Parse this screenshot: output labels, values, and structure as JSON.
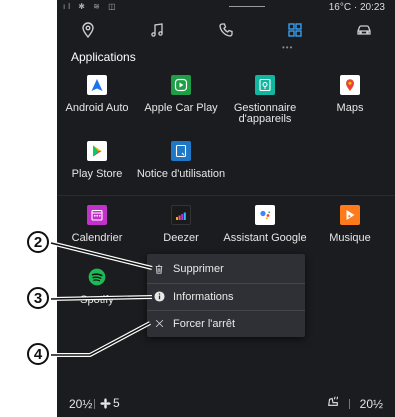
{
  "status_bar": {
    "left_icons": "ıl ✱ ≋ ◫",
    "right_text": "16°C · 20:23"
  },
  "top_nav": [
    {
      "name": "navigation",
      "icon": "location-pin-icon"
    },
    {
      "name": "music",
      "icon": "music-note-icon"
    },
    {
      "name": "phone",
      "icon": "phone-icon"
    },
    {
      "name": "apps",
      "icon": "apps-grid-icon",
      "active": true
    },
    {
      "name": "vehicle",
      "icon": "car-icon"
    }
  ],
  "section_title": "Applications",
  "apps": [
    {
      "label": "Android Auto",
      "color": "#ffffff",
      "icon": "android-auto-icon"
    },
    {
      "label": "Apple Car Play",
      "color": "#1e9e46",
      "icon": "carplay-icon"
    },
    {
      "label": "Gestionnaire d'appareils",
      "color": "#12b5a0",
      "icon": "device-manager-icon"
    },
    {
      "label": "Maps",
      "color": "#ffffff",
      "icon": "maps-icon"
    },
    {
      "label": "Play Store",
      "color": "#ffffff",
      "icon": "play-store-icon"
    },
    {
      "label": "Notice d'utilisation",
      "color": "#1f77c8",
      "icon": "manual-icon"
    },
    {
      "label": "Calendrier",
      "color": "#c231c9",
      "icon": "calendar-icon"
    },
    {
      "label": "Deezer",
      "color": "#1a1a1a",
      "icon": "deezer-icon"
    },
    {
      "label": "Assistant Google",
      "color": "#ffffff",
      "icon": "google-assistant-icon"
    },
    {
      "label": "Musique",
      "color": "#ff7a1a",
      "icon": "music-play-icon"
    },
    {
      "label": "Spotify",
      "color": "#1db954",
      "icon": "spotify-icon"
    }
  ],
  "context_menu": [
    {
      "label": "Supprimer",
      "icon": "trash-icon"
    },
    {
      "label": "Informations",
      "icon": "info-icon"
    },
    {
      "label": "Forcer l'arrêt",
      "icon": "close-icon"
    }
  ],
  "callouts": [
    "2",
    "3",
    "4"
  ],
  "bottom_bar": {
    "left_temp": "20½",
    "fan_level": "5",
    "right_temp": "20½"
  }
}
